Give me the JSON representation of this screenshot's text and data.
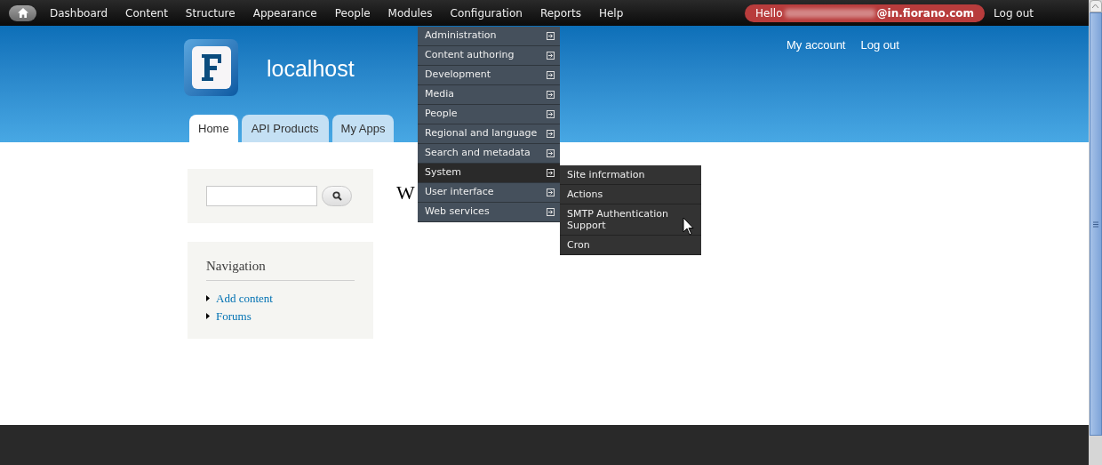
{
  "toolbar": {
    "items": [
      {
        "label": "Dashboard"
      },
      {
        "label": "Content"
      },
      {
        "label": "Structure"
      },
      {
        "label": "Appearance"
      },
      {
        "label": "People"
      },
      {
        "label": "Modules"
      },
      {
        "label": "Configuration"
      },
      {
        "label": "Reports"
      },
      {
        "label": "Help"
      }
    ],
    "greeting": {
      "prefix": "Hello",
      "suffix": "@in.fiorano.com"
    },
    "logout": "Log out"
  },
  "configuration_menu": {
    "items": [
      {
        "label": "Administration",
        "selected": false
      },
      {
        "label": "Content authoring",
        "selected": false
      },
      {
        "label": "Development",
        "selected": false
      },
      {
        "label": "Media",
        "selected": false
      },
      {
        "label": "People",
        "selected": false
      },
      {
        "label": "Regional and language",
        "selected": false
      },
      {
        "label": "Search and metadata",
        "selected": false
      },
      {
        "label": "System",
        "selected": true
      },
      {
        "label": "User interface",
        "selected": false
      },
      {
        "label": "Web services",
        "selected": false
      }
    ],
    "submenu": [
      "Site infcrmation",
      "Actions",
      "SMTP Authentication Support",
      "Cron"
    ]
  },
  "header": {
    "site_name": "localhost",
    "secondary_links": [
      "My account",
      "Log out"
    ],
    "tabs": [
      {
        "label": "Home",
        "selected": true
      },
      {
        "label": "API Products",
        "selected": false
      },
      {
        "label": "My Apps",
        "selected": false
      }
    ]
  },
  "sidebar": {
    "navigation": {
      "title": "Navigation",
      "links": [
        "Add content",
        "Forums"
      ]
    }
  },
  "main": {
    "title": "W"
  }
}
